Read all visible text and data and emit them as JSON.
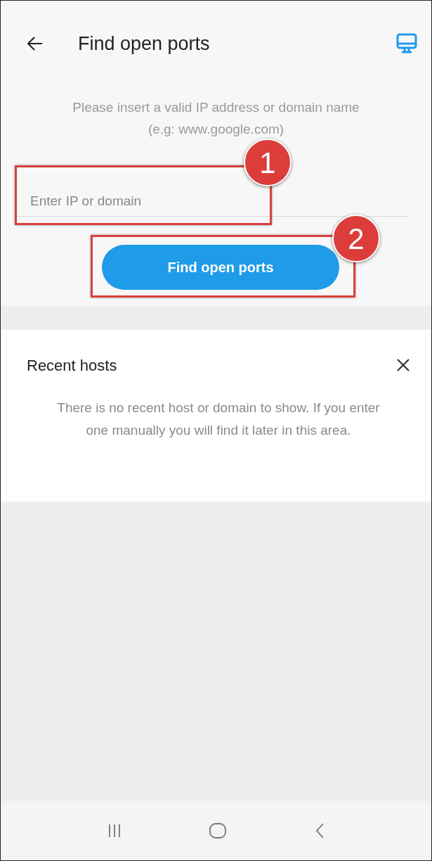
{
  "app_bar": {
    "title": "Find open ports"
  },
  "instructions": "Please insert a valid IP address or domain name (e.g: www.google.com)",
  "host_field": {
    "placeholder": "Enter IP or domain"
  },
  "primary_button": {
    "label": "Find open ports"
  },
  "recent_hosts": {
    "title": "Recent hosts",
    "empty_message": "There is no recent host or domain to show. If you enter one manually you will find it later in this area."
  },
  "annotations": [
    {
      "label": "1"
    },
    {
      "label": "2"
    }
  ],
  "nav_bar": [
    {
      "kind": "recents"
    },
    {
      "kind": "home"
    },
    {
      "kind": "back"
    }
  ]
}
